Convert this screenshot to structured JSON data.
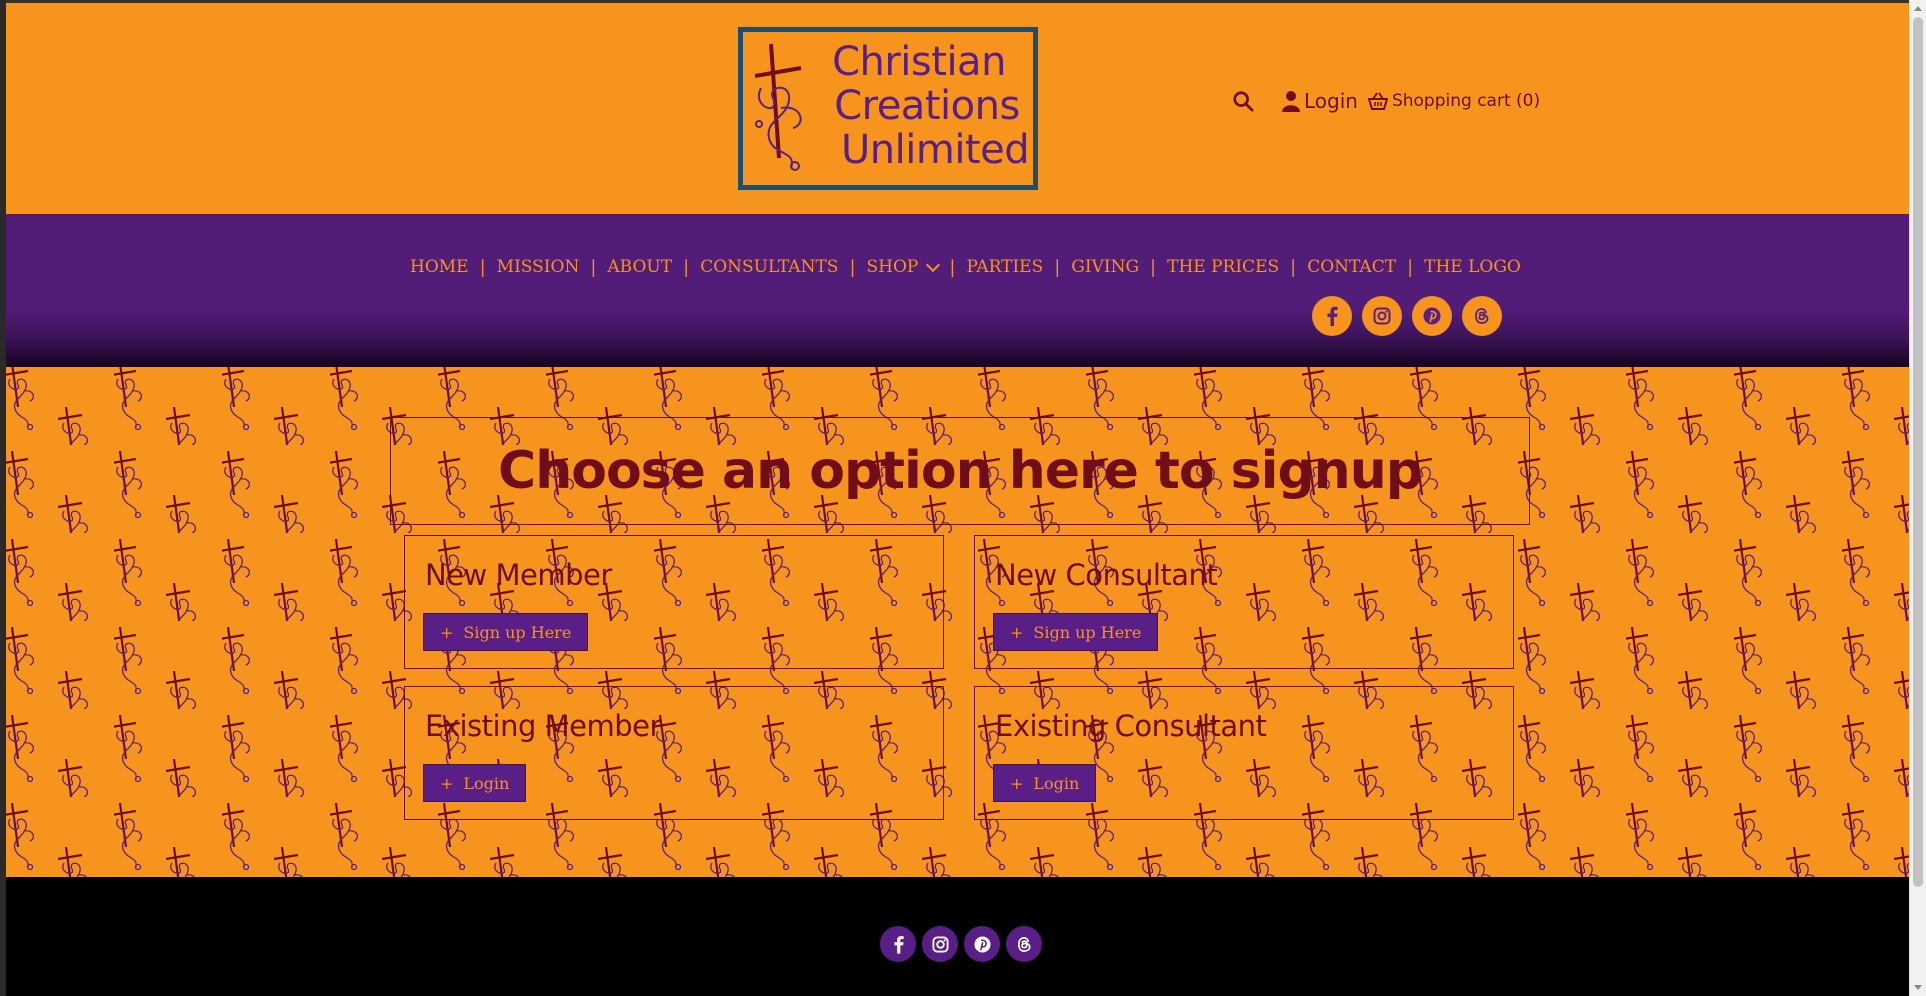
{
  "header": {
    "logo": {
      "line1": "Christian",
      "line2": "Creations",
      "line3": "Unlimited"
    },
    "login_label": "Login",
    "cart_label": "Shopping cart (0)"
  },
  "nav": {
    "items": [
      {
        "label": "HOME"
      },
      {
        "label": "MISSION"
      },
      {
        "label": "ABOUT"
      },
      {
        "label": "CONSULTANTS"
      },
      {
        "label": "SHOP"
      },
      {
        "label": "PARTIES"
      },
      {
        "label": "GIVING"
      },
      {
        "label": "THE PRICES"
      },
      {
        "label": "CONTACT"
      },
      {
        "label": "THE LOGO"
      }
    ],
    "separator": "|"
  },
  "main": {
    "title": "Choose an option here to signup",
    "cards": [
      {
        "title": "New Member",
        "button": "Sign up Here"
      },
      {
        "title": "New Consultant",
        "button": "Sign up Here"
      },
      {
        "title": "Existing Member",
        "button": "Login"
      },
      {
        "title": "Existing Consultant",
        "button": "Login"
      }
    ],
    "button_prefix": "+"
  },
  "social_icons": [
    "facebook-icon",
    "instagram-icon",
    "pinterest-icon",
    "threads-icon"
  ],
  "colors": {
    "orange": "#f7941d",
    "purple": "#5a1f87",
    "maroon": "#6f0d18",
    "logo_border": "#1f4e6b"
  }
}
